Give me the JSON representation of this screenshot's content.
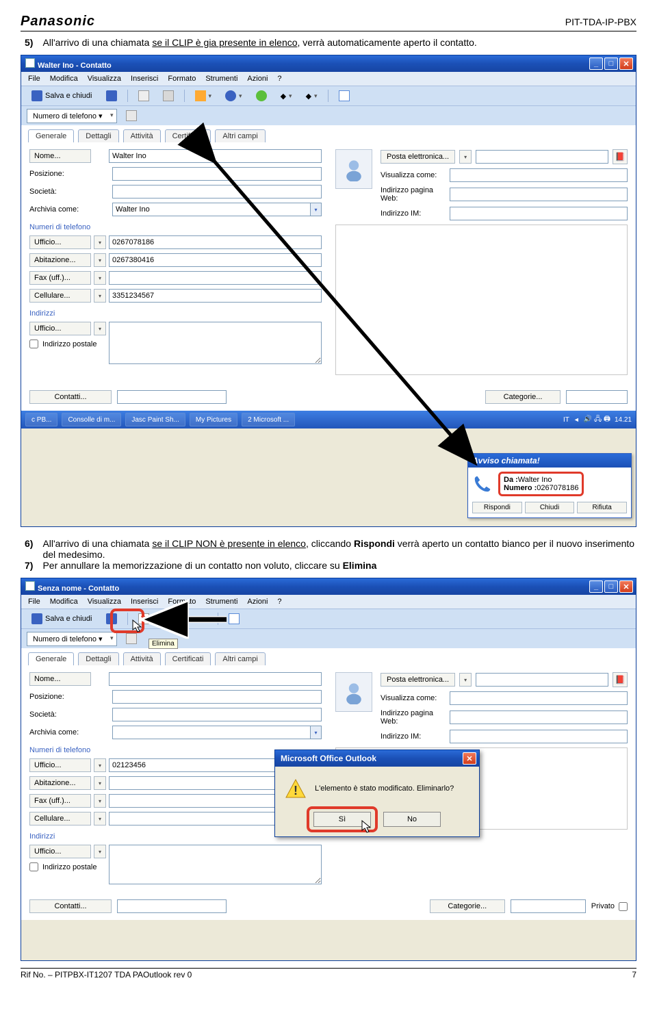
{
  "header": {
    "brand": "Panasonic",
    "code": "PIT-TDA-IP-PBX"
  },
  "para5": {
    "num": "5)",
    "t1": "All'arrivo di una chiamata ",
    "u": "se il CLIP è gia presente in elenco",
    "t2": ", verrà automaticamente aperto il contatto."
  },
  "win1": {
    "title": "Walter Ino - Contatto",
    "menu": [
      "File",
      "Modifica",
      "Visualizza",
      "Inserisci",
      "Formato",
      "Strumenti",
      "Azioni",
      "?"
    ],
    "save_close": "Salva e chiudi",
    "phone_combo": "Numero di telefono ▾",
    "tabs": [
      "Generale",
      "Dettagli",
      "Attività",
      "Certificati",
      "Altri campi"
    ],
    "left": {
      "nome_btn": "Nome...",
      "nome_val": "Walter Ino",
      "pos_lbl": "Posizione:",
      "pos_val": "",
      "soc_lbl": "Società:",
      "soc_val": "",
      "arch_lbl": "Archivia come:",
      "arch_val": "Walter Ino",
      "grp_tel": "Numeri di telefono",
      "uff_btn": "Ufficio...",
      "uff_val": "0267078186",
      "abi_btn": "Abitazione...",
      "abi_val": "0267380416",
      "fax_btn": "Fax (uff.)...",
      "fax_val": "",
      "cel_btn": "Cellulare...",
      "cel_val": "3351234567",
      "grp_ind": "Indirizzi",
      "uff2_btn": "Ufficio...",
      "chk_post": "Indirizzo postale"
    },
    "right": {
      "email_btn": "Posta elettronica...",
      "vis_lbl": "Visualizza come:",
      "web_lbl": "Indirizzo pagina Web:",
      "im_lbl": "Indirizzo IM:"
    },
    "bottom": {
      "contatti": "Contatti...",
      "categorie": "Categorie..."
    },
    "popup": {
      "title": "Avviso chiamata!",
      "da_lbl": "Da :",
      "da_val": "Walter Ino",
      "num_lbl": "Numero :",
      "num_val": "0267078186",
      "b1": "Rispondi",
      "b2": "Chiudi",
      "b3": "Rifiuta"
    },
    "taskbar": {
      "b1": "c PB...",
      "b2": "Consolle di m...",
      "b3": "Jasc Paint Sh...",
      "b4": "My Pictures",
      "b5": "2 Microsoft ...",
      "lang": "IT",
      "time": "14.21"
    }
  },
  "para6": {
    "num": "6)",
    "t1": "All'arrivo di una chiamata ",
    "u": "se il CLIP NON è presente in elenco",
    "t2": ", cliccando ",
    "b": "Rispondi",
    "t3": " verrà aperto un contatto bianco per il nuovo inserimento del medesimo."
  },
  "para7": {
    "num": "7)",
    "t1": "Per annullare la memorizzazione di un contatto non voluto, cliccare su ",
    "b": "Elimina"
  },
  "win2": {
    "title": "Senza nome - Contatto",
    "menu": [
      "File",
      "Modifica",
      "Visualizza",
      "Inserisci",
      "Formato",
      "Strumenti",
      "Azioni",
      "?"
    ],
    "save_close": "Salva e chiudi",
    "tooltip": "Elimina",
    "phone_combo": "Numero di telefono ▾",
    "tabs": [
      "Generale",
      "Dettagli",
      "Attività",
      "Certificati",
      "Altri campi"
    ],
    "left": {
      "nome_btn": "Nome...",
      "nome_val": "",
      "pos_lbl": "Posizione:",
      "pos_val": "",
      "soc_lbl": "Società:",
      "soc_val": "",
      "arch_lbl": "Archivia come:",
      "arch_val": "",
      "grp_tel": "Numeri di telefono",
      "uff_btn": "Ufficio...",
      "uff_val": "02123456",
      "abi_btn": "Abitazione...",
      "fax_btn": "Fax (uff.)...",
      "cel_btn": "Cellulare...",
      "grp_ind": "Indirizzi",
      "uff2_btn": "Ufficio...",
      "chk_post": "Indirizzo postale"
    },
    "right": {
      "email_btn": "Posta elettronica...",
      "vis_lbl": "Visualizza come:",
      "web_lbl": "Indirizzo pagina Web:",
      "im_lbl": "Indirizzo IM:"
    },
    "bottom": {
      "contatti": "Contatti...",
      "categorie": "Categorie...",
      "privato": "Privato"
    },
    "dialog": {
      "title": "Microsoft Office Outlook",
      "msg": "L'elemento è stato modificato. Eliminarlo?",
      "yes": "Sì",
      "no": "No"
    }
  },
  "footer": {
    "ref": "Rif No. – PITPBX-IT1207 TDA PAOutlook rev 0",
    "page": "7"
  }
}
